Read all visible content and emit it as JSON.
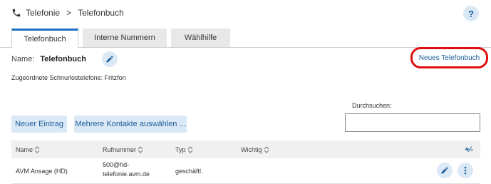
{
  "breadcrumb": {
    "root": "Telefonie",
    "separator": ">",
    "current": "Telefonbuch"
  },
  "help": {
    "label": "?"
  },
  "tabs": [
    {
      "label": "Telefonbuch",
      "active": true
    },
    {
      "label": "Interne Nummern",
      "active": false
    },
    {
      "label": "Wählhilfe",
      "active": false
    }
  ],
  "phonebook": {
    "name_label": "Name:",
    "name_value": "Telefonbuch",
    "new_book_label": "Neues Telefonbuch",
    "assigned_text": "Zugeordnete Schnurlostelefone: Fritzfon"
  },
  "actions": {
    "new_entry": "Neuer Eintrag",
    "select_multiple": "Mehrere Kontakte auswählen ..."
  },
  "search": {
    "label": "Durchsuchen:",
    "value": ""
  },
  "table": {
    "columns": [
      "Name",
      "Rufnummer",
      "Typ",
      "Wichtig"
    ],
    "expand_label": "+⁄-",
    "rows": [
      {
        "name": "AVM Ansage (HD)",
        "number_line1": "500@hd-",
        "number_line2": "telefonie.avm.de",
        "type": "geschäftl.",
        "important": ""
      }
    ]
  },
  "colors": {
    "accent": "#1a5b99",
    "button_bg": "#dbe9f6",
    "highlight": "#e01010",
    "tab_active": "#1a6fc3"
  }
}
